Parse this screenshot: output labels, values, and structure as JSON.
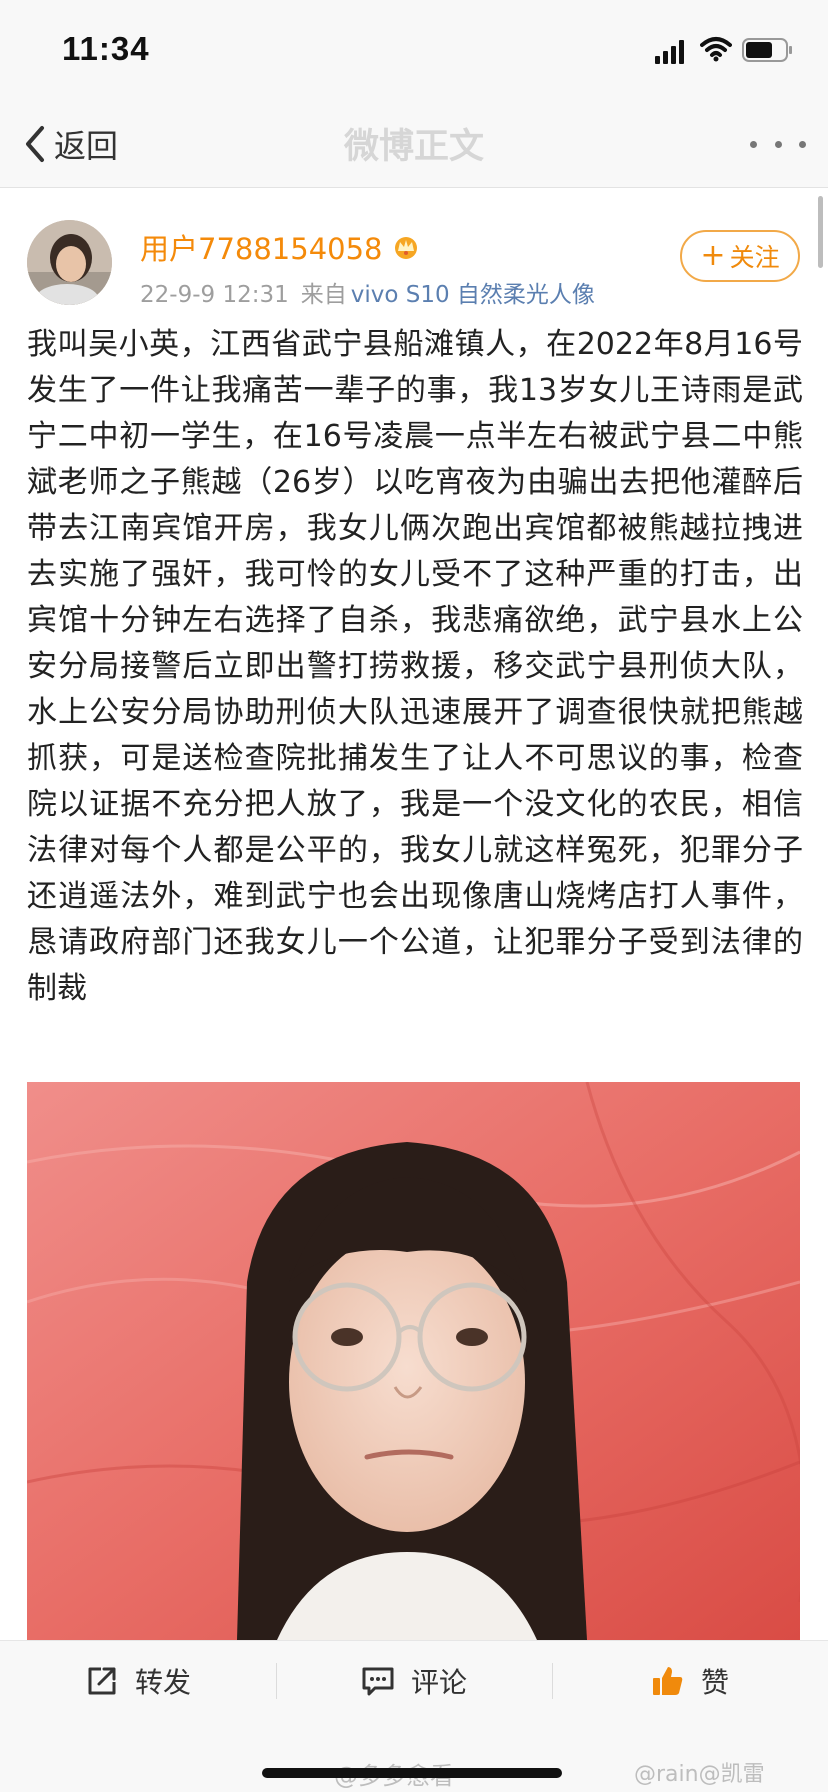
{
  "status_bar": {
    "time": "11:34"
  },
  "nav": {
    "back_label": "返回",
    "title": "微博正文"
  },
  "post": {
    "username": "用户7788154058",
    "date": "22-9-9 12:31",
    "via_label": "来自",
    "device": "vivo S10 自然柔光人像",
    "follow_label": "关注",
    "body": "我叫吴小英，江西省武宁县船滩镇人，在2022年8月16号发生了一件让我痛苦一辈子的事，我13岁女儿王诗雨是武宁二中初一学生，在16号凌晨一点半左右被武宁县二中熊斌老师之子熊越（26岁）以吃宵夜为由骗出去把他灌醉后带去江南宾馆开房，我女儿俩次跑出宾馆都被熊越拉拽进去实施了强奸，我可怜的女儿受不了这种严重的打击，出宾馆十分钟左右选择了自杀，我悲痛欲绝，武宁县水上公安分局接警后立即出警打捞救援，移交武宁县刑侦大队，水上公安分局协助刑侦大队迅速展开了调查很快就把熊越抓获，可是送检查院批捕发生了让人不可思议的事，检查院以证据不充分把人放了，我是一个没文化的农民，相信法律对每个人都是公平的，我女儿就这样冤死，犯罪分子还逍遥法外，难到武宁也会出现像唐山烧烤店打人事件，恳请政府部门还我女儿一个公道，让犯罪分子受到法律的制裁"
  },
  "toolbar": {
    "repost_label": "转发",
    "comment_label": "评论",
    "like_label": "赞"
  },
  "watermarks": {
    "left": "@多多愈看",
    "right": "@rain@凯雷"
  },
  "colors": {
    "accent_orange": "#f48a0a",
    "link_blue": "#5b7fb0",
    "like_orange": "#f08a0c"
  }
}
